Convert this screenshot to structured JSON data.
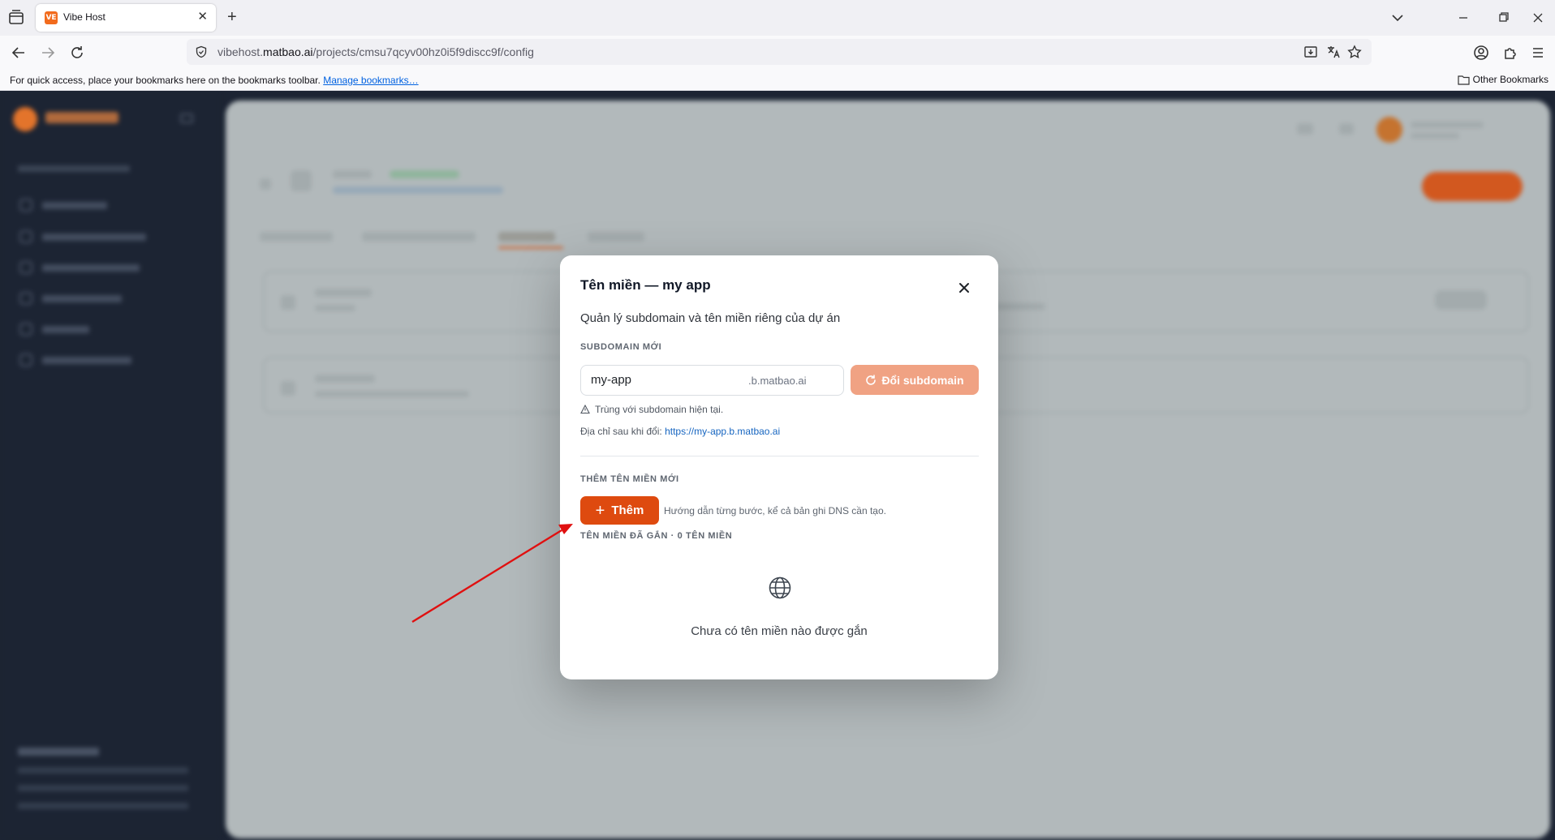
{
  "browser": {
    "tab": {
      "title": "Vibe Host",
      "favicon_text": "VE"
    },
    "url": {
      "domain_prefix": "vibehost.",
      "domain_main": "matbao.ai",
      "path": "/projects/cmsu7qcyv00hz0i5f9discc9f/config"
    },
    "bookmarks_bar": {
      "message": "For quick access, place your bookmarks here on the bookmarks toolbar.",
      "link": "Manage bookmarks…",
      "other": "Other Bookmarks"
    }
  },
  "modal": {
    "title": "Tên miền — my app",
    "description": "Quản lý subdomain và tên miền riêng của dự án",
    "subdomain_section": "SUBDOMAIN MỚI",
    "subdomain_value": "my-app",
    "subdomain_suffix": ".b.matbao.ai",
    "change_button": "Đổi subdomain",
    "warning": "Trùng với subdomain hiện tại.",
    "address_label": "Địa chỉ sau khi đổi:",
    "address_url": "https://my-app.b.matbao.ai",
    "add_section": "THÊM TÊN MIỀN MỚI",
    "add_button": "Thêm",
    "add_hint": "Hướng dẫn từng bước, kể cả bản ghi DNS cần tạo.",
    "attached_section": "TÊN MIỀN ĐÃ GẮN · 0 TÊN MIỀN",
    "empty_text": "Chưa có tên miền nào được gắn"
  },
  "colors": {
    "accent": "#de4a0f",
    "accent_disabled": "#f0a283",
    "link": "#1665c0"
  }
}
